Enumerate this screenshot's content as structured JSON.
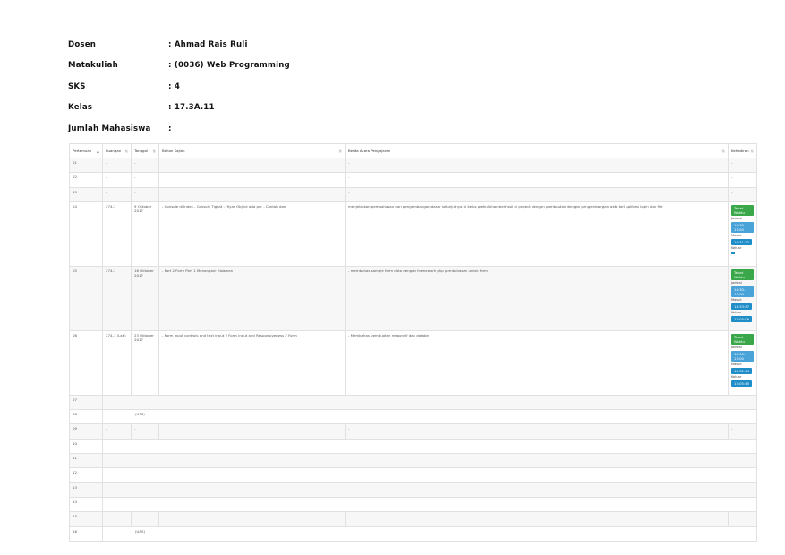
{
  "header": {
    "dosen_label": "Dosen",
    "dosen_value": ": Ahmad Rais Ruli",
    "matakuliah_label": "Matakuliah",
    "matakuliah_value": ": (0036) Web Programming",
    "sks_label": "SKS",
    "sks_value": ": 4",
    "kelas_label": "Kelas",
    "kelas_value": ": 17.3A.11",
    "jumlah_label": "Jumlah Mahasiswa",
    "jumlah_value": ":"
  },
  "table": {
    "columns": [
      "Pertemuan",
      "Ruangan",
      "Tanggal",
      "Bahan Kajian",
      "Berita Acara Pengajaran",
      "Kehadiran"
    ],
    "rows": [
      {
        "no": "01",
        "ruangan": "-",
        "tanggal": "-",
        "bahan": "",
        "berita": "-",
        "kehadiran": "-"
      },
      {
        "no": "02",
        "ruangan": "-",
        "tanggal": "-",
        "bahan": "",
        "berita": "-",
        "kehadiran": "-"
      },
      {
        "no": "03",
        "ruangan": "-",
        "tanggal": "-",
        "bahan": "",
        "berita": "-",
        "kehadiran": "-"
      },
      {
        "no": "04",
        "ruangan": "274-1",
        "tanggal": "9 Oktober 2017",
        "bahan": "- Console di Index - Console Tigkat - Hlyas Object ada per - Contoh dan",
        "berita": "menjelaskan pembahasan dan pengembangan dasar selanjutnya di kelas perkuliahan berhasil di project dengan pembuatan dengan pengembangan web dari aplikasi login dan file",
        "kehadiran": {
          "status": "Tepat Waktu",
          "jadwal_label": "Jadwal",
          "jadwal": "14:30-17:00",
          "masuk_label": "Masuk",
          "masuk": "14:31:22",
          "keluar_label": "Keluar"
        }
      },
      {
        "no": "05",
        "ruangan": "274-1",
        "tanggal": "16 Oktober 2017",
        "bahan": "- Part 2 Form Part 1 Menangani Halaman",
        "berita": "- membahas sample form data dengan framework php pembahasan untuk form",
        "kehadiran": {
          "status": "Tepat Waktu",
          "jadwal_label": "Jadwal",
          "jadwal": "14:30-17:00",
          "masuk_label": "Masuk",
          "masuk": "14:33:57",
          "keluar_label": "Keluar",
          "keluar": "17:05:09"
        }
      },
      {
        "no": "06",
        "ruangan": "274-1 (Lab)",
        "tanggal": "23 Oktober 2017",
        "bahan": "- Form Input controls and text input 2 Form Input and Responsiveness 2 Form",
        "berita": "- Membahas pembuatan responsif dan databe",
        "kehadiran": {
          "status": "Tepat Waktu",
          "jadwal_label": "Jadwal",
          "jadwal": "14:30-17:00",
          "masuk_label": "Masuk",
          "masuk": "14:32:44",
          "keluar_label": "Keluar",
          "keluar": "17:05:45"
        }
      },
      {
        "no": "07",
        "ruangan": "",
        "tanggal": "",
        "bahan": "",
        "berita": "",
        "kehadiran": ""
      },
      {
        "no": "08",
        "ruangan": "",
        "tanggal": "",
        "bahan": "(UTS)",
        "berita": "",
        "kehadiran": ""
      },
      {
        "no": "09",
        "ruangan": "-",
        "tanggal": "-",
        "bahan": "",
        "berita": "-",
        "kehadiran": "-"
      },
      {
        "no": "10",
        "ruangan": "",
        "tanggal": "",
        "bahan": "",
        "berita": "",
        "kehadiran": ""
      },
      {
        "no": "11",
        "ruangan": "",
        "tanggal": "",
        "bahan": "",
        "berita": "",
        "kehadiran": ""
      },
      {
        "no": "12",
        "ruangan": "",
        "tanggal": "",
        "bahan": "",
        "berita": "",
        "kehadiran": ""
      },
      {
        "no": "13",
        "ruangan": "",
        "tanggal": "",
        "bahan": "",
        "berita": "",
        "kehadiran": ""
      },
      {
        "no": "14",
        "ruangan": "",
        "tanggal": "",
        "bahan": "",
        "berita": "",
        "kehadiran": ""
      },
      {
        "no": "15",
        "ruangan": "-",
        "tanggal": "-",
        "bahan": "",
        "berita": "-",
        "kehadiran": "-"
      },
      {
        "no": "16",
        "ruangan": "",
        "tanggal": "",
        "bahan": "(UAS)",
        "berita": "",
        "kehadiran": ""
      }
    ]
  },
  "colors": {
    "green": "#3aa84a",
    "blue": "#1e8dc8",
    "lightblue": "#4aa3d8"
  }
}
